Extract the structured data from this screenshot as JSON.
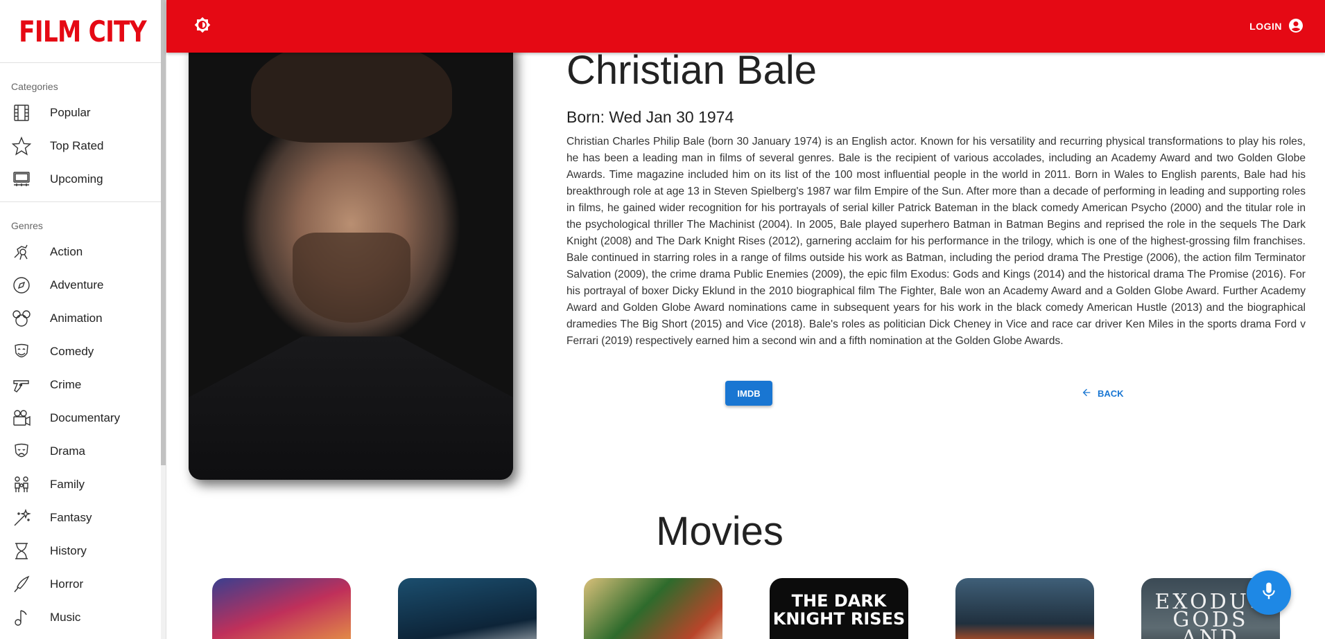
{
  "app": {
    "logo": "FILM CITY"
  },
  "sidebar": {
    "categories_title": "Categories",
    "categories": [
      {
        "label": "Popular",
        "icon": "film-icon"
      },
      {
        "label": "Top Rated",
        "icon": "star-icon"
      },
      {
        "label": "Upcoming",
        "icon": "theater-icon"
      }
    ],
    "genres_title": "Genres",
    "genres": [
      {
        "label": "Action",
        "icon": "action-icon"
      },
      {
        "label": "Adventure",
        "icon": "compass-icon"
      },
      {
        "label": "Animation",
        "icon": "mouse-ears-icon"
      },
      {
        "label": "Comedy",
        "icon": "comedy-mask-icon"
      },
      {
        "label": "Crime",
        "icon": "gun-icon"
      },
      {
        "label": "Documentary",
        "icon": "camera-icon"
      },
      {
        "label": "Drama",
        "icon": "drama-mask-icon"
      },
      {
        "label": "Family",
        "icon": "family-icon"
      },
      {
        "label": "Fantasy",
        "icon": "magic-wand-icon"
      },
      {
        "label": "History",
        "icon": "hourglass-icon"
      },
      {
        "label": "Horror",
        "icon": "knife-icon"
      },
      {
        "label": "Music",
        "icon": "music-note-icon"
      }
    ]
  },
  "topbar": {
    "login_label": "LOGIN",
    "brand_color": "#e50914"
  },
  "actor": {
    "name": "Christian Bale",
    "born": "Born: Wed Jan 30 1974",
    "bio": "Christian Charles Philip Bale (born 30 January 1974) is an English actor. Known for his versatility and recurring physical transformations to play his roles, he has been a leading man in films of several genres. Bale is the recipient of various accolades, including an Academy Award and two Golden Globe Awards. Time magazine included him on its list of the 100 most influential people in the world in 2011. Born in Wales to English parents, Bale had his breakthrough role at age 13 in Steven Spielberg's 1987 war film Empire of the Sun. After more than a decade of performing in leading and supporting roles in films, he gained wider recognition for his portrayals of serial killer Patrick Bateman in the black comedy American Psycho (2000) and the titular role in the psychological thriller The Machinist (2004). In 2005, Bale played superhero Batman in Batman Begins and reprised the role in the sequels The Dark Knight (2008) and The Dark Knight Rises (2012), garnering acclaim for his performance in the trilogy, which is one of the highest-grossing film franchises. Bale continued in starring roles in a range of films outside his work as Batman, including the period drama The Prestige (2006), the action film Terminator Salvation (2009), the crime drama Public Enemies (2009), the epic film Exodus: Gods and Kings (2014) and the historical drama The Promise (2016). For his portrayal of boxer Dicky Eklund in the 2010 biographical film The Fighter, Bale won an Academy Award and a Golden Globe Award. Further Academy Award and Golden Globe Award nominations came in subsequent years for his work in the black comedy American Hustle (2013) and the biographical dramedies The Big Short (2015) and Vice (2018). Bale's roles as politician Dick Cheney in Vice and race car driver Ken Miles in the sports drama Ford v Ferrari (2019) respectively earned him a second win and a fifth nomination at the Golden Globe Awards.",
    "imdb_label": "IMDB",
    "back_label": "BACK"
  },
  "movies": {
    "title": "Movies",
    "posters": [
      {
        "text": "",
        "bg": "linear-gradient(160deg,#3a3f8f 0%,#c0305a 45%,#f0b040 100%)",
        "color": "#fff"
      },
      {
        "text": "",
        "bg": "linear-gradient(170deg,#1b4e6e 0%,#0d2438 60%,#e8e8e8 100%)",
        "color": "#fff"
      },
      {
        "text": "",
        "bg": "linear-gradient(135deg,#d9c07a 0%,#2e6b2c 40%,#b8452a 75%,#f2e6c0 100%)",
        "color": "#fff"
      },
      {
        "text": "THE DARK KNIGHT RISES",
        "bg": "#0c0c0c",
        "color": "#ffffff"
      },
      {
        "text": "",
        "bg": "linear-gradient(180deg,#3f5f78 0%,#20303e 55%,#e5581c 85%,#2a1408 100%)",
        "color": "#fff"
      },
      {
        "text": "EXODUS GODS AND KINGS",
        "bg": "linear-gradient(180deg,#3b4a55 0%,#5d6b72 60%,#2b3338 100%)",
        "color": "#f0f0f0"
      }
    ]
  },
  "accent_color": "#1976d2"
}
